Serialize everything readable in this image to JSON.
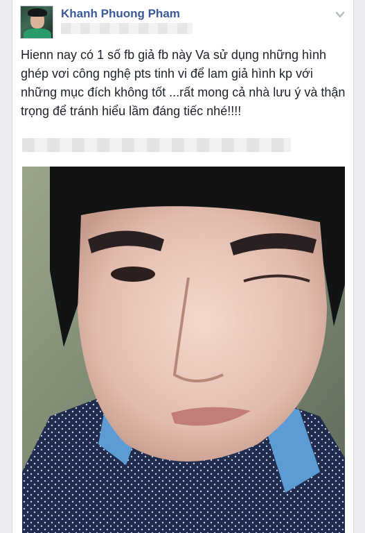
{
  "post": {
    "author": "Khanh Phuong Pham",
    "text": "Hienn nay có 1 số fb giả fb này   Va sử dụng những hình ghép vơi  công nghệ pts tinh vi để lam giả hình kp với những mục đích không tốt ...rất mong cả nhà lưu ý và thận trọng để tránh hiểu lầm đáng tiếc nhé!!!!"
  },
  "icons": {
    "options": "chevron-down-icon"
  },
  "colors": {
    "author_link": "#3b5998",
    "text": "#1d2129",
    "page_bg": "#e9ebee"
  }
}
